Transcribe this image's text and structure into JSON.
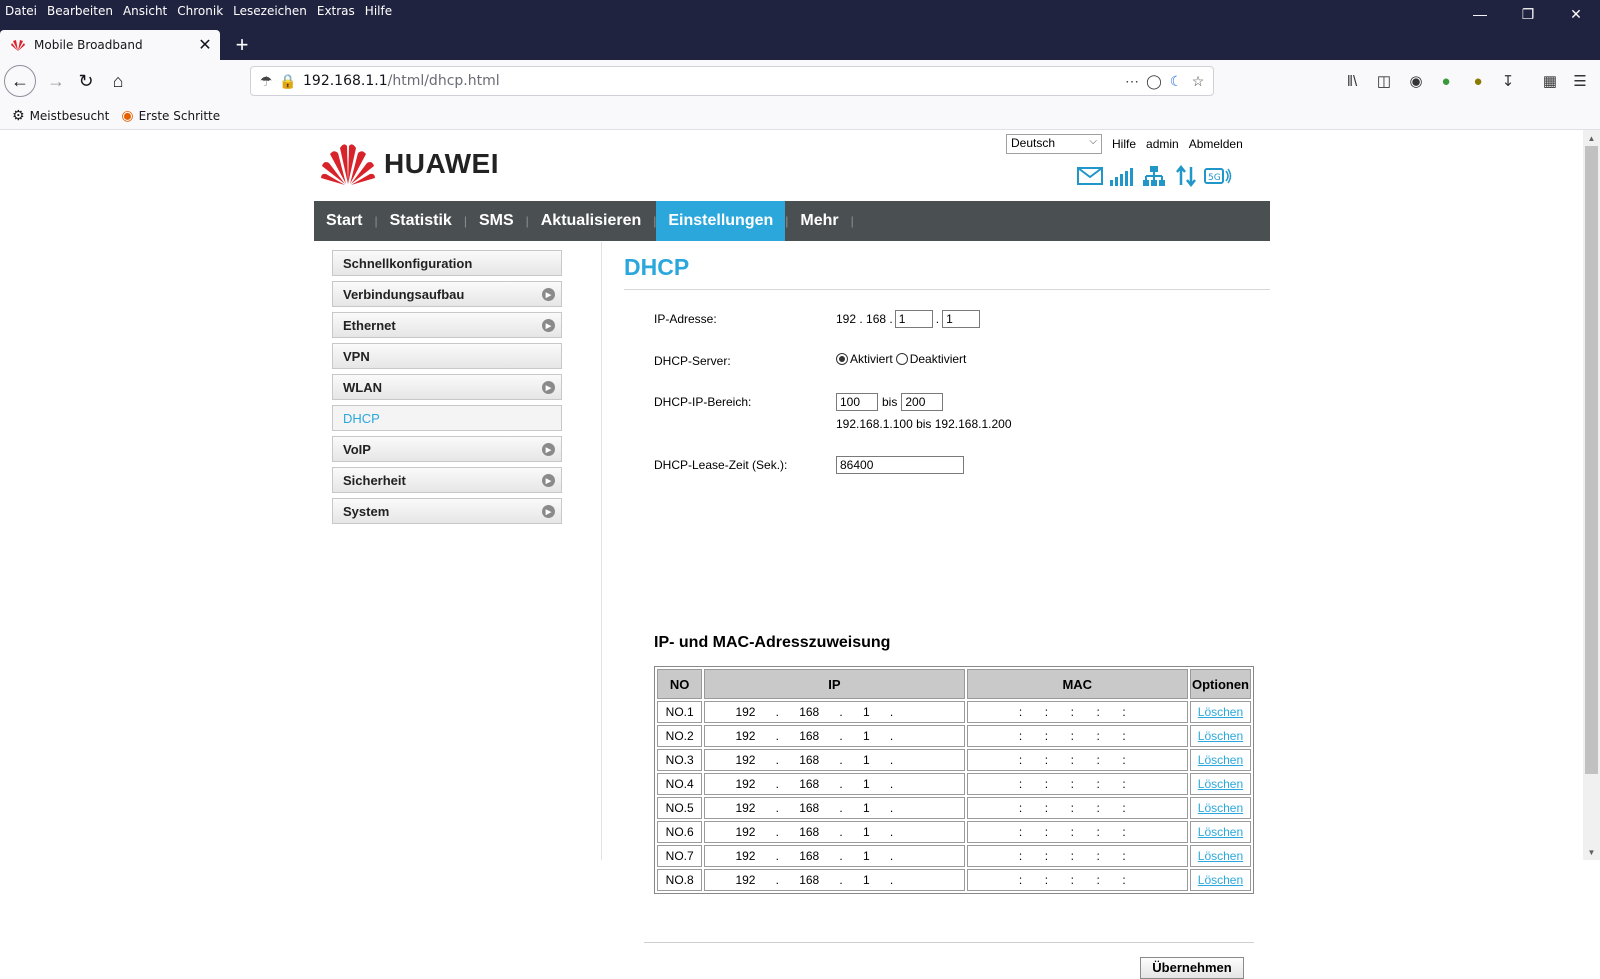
{
  "browser": {
    "menu": [
      "Datei",
      "Bearbeiten",
      "Ansicht",
      "Chronik",
      "Lesezeichen",
      "Extras",
      "Hilfe"
    ],
    "tab_title": "Mobile Broadband",
    "url_host": "192.168.1.1",
    "url_path": "/html/dhcp.html",
    "bookmarks": [
      "Meistbesucht",
      "Erste Schritte"
    ]
  },
  "header": {
    "language": "Deutsch",
    "links": [
      "Hilfe",
      "admin",
      "Abmelden"
    ],
    "brand": "HUAWEI"
  },
  "nav": {
    "items": [
      "Start",
      "Statistik",
      "SMS",
      "Aktualisieren",
      "Einstellungen",
      "Mehr"
    ],
    "active": "Einstellungen"
  },
  "sidebar": {
    "items": [
      {
        "label": "Schnellkonfiguration",
        "arrow": false
      },
      {
        "label": "Verbindungsaufbau",
        "arrow": true
      },
      {
        "label": "Ethernet",
        "arrow": true
      },
      {
        "label": "VPN",
        "arrow": false
      },
      {
        "label": "WLAN",
        "arrow": true
      },
      {
        "label": "DHCP",
        "arrow": false,
        "active": true
      },
      {
        "label": "VoIP",
        "arrow": true
      },
      {
        "label": "Sicherheit",
        "arrow": true
      },
      {
        "label": "System",
        "arrow": true
      }
    ]
  },
  "dhcp": {
    "title": "DHCP",
    "ip_label": "IP-Adresse:",
    "ip_prefix": "192 . 168 .",
    "ip_third": "1",
    "ip_fourth": "1",
    "server_label": "DHCP-Server:",
    "server_on": "Aktiviert",
    "server_off": "Deaktiviert",
    "range_label": "DHCP-IP-Bereich:",
    "range_start": "100",
    "range_sep": "bis",
    "range_end": "200",
    "range_text": "192.168.1.100 bis 192.168.1.200",
    "lease_label": "DHCP-Lease-Zeit (Sek.):",
    "lease_value": "86400"
  },
  "assignment": {
    "heading": "IP- und MAC-Adresszuweisung",
    "columns": [
      "NO",
      "IP",
      "MAC",
      "Optionen"
    ],
    "rows": [
      {
        "no": "NO.1",
        "ip": [
          "192",
          "168",
          "1",
          ""
        ],
        "action": "Löschen"
      },
      {
        "no": "NO.2",
        "ip": [
          "192",
          "168",
          "1",
          ""
        ],
        "action": "Löschen"
      },
      {
        "no": "NO.3",
        "ip": [
          "192",
          "168",
          "1",
          ""
        ],
        "action": "Löschen"
      },
      {
        "no": "NO.4",
        "ip": [
          "192",
          "168",
          "1",
          ""
        ],
        "action": "Löschen"
      },
      {
        "no": "NO.5",
        "ip": [
          "192",
          "168",
          "1",
          ""
        ],
        "action": "Löschen"
      },
      {
        "no": "NO.6",
        "ip": [
          "192",
          "168",
          "1",
          ""
        ],
        "action": "Löschen"
      },
      {
        "no": "NO.7",
        "ip": [
          "192",
          "168",
          "1",
          ""
        ],
        "action": "Löschen"
      },
      {
        "no": "NO.8",
        "ip": [
          "192",
          "168",
          "1",
          ""
        ],
        "action": "Löschen"
      }
    ]
  },
  "apply_label": "Übernehmen",
  "colors": {
    "accent": "#2ba7dc",
    "nav_bg": "#4a4f51",
    "titlebar": "#202340"
  }
}
